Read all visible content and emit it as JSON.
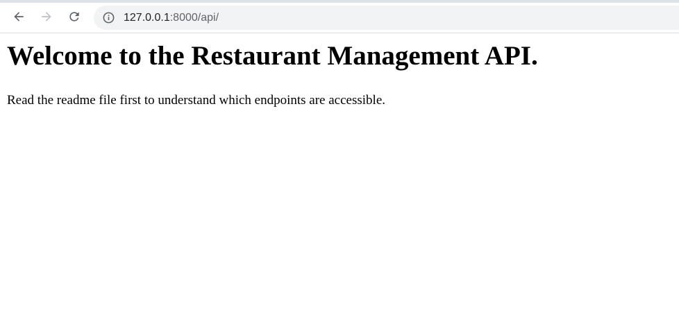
{
  "browser": {
    "nav": {
      "back_icon": "back-arrow-icon",
      "forward_icon": "forward-arrow-icon",
      "reload_icon": "reload-icon"
    },
    "address_bar": {
      "info_icon": "info-circle-icon",
      "host": "127.0.0.1",
      "rest": ":8000/api/"
    }
  },
  "page": {
    "heading": "Welcome to the Restaurant Management API.",
    "text": "Read the readme file first to understand which endpoints are accessible."
  },
  "colors": {
    "toolbar_bg": "#ffffff",
    "omnibox_bg": "#f1f3f4",
    "icon_active": "#5f6368",
    "icon_disabled": "#bdc1c6"
  }
}
